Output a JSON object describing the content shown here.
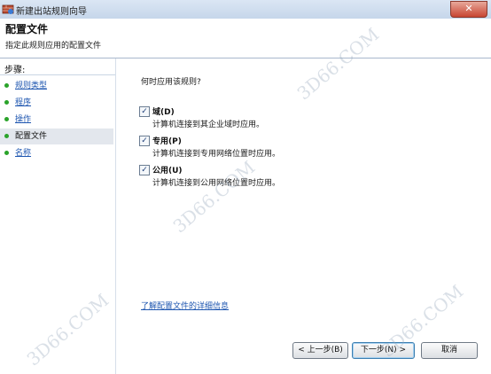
{
  "window": {
    "title": "新建出站规则向导",
    "close_glyph": "✕"
  },
  "header": {
    "title": "配置文件",
    "subtitle": "指定此规则应用的配置文件"
  },
  "sidebar": {
    "label": "步骤:",
    "items": [
      {
        "label": "规则类型",
        "state": "link"
      },
      {
        "label": "程序",
        "state": "link"
      },
      {
        "label": "操作",
        "state": "link"
      },
      {
        "label": "配置文件",
        "state": "current"
      },
      {
        "label": "名称",
        "state": "link"
      }
    ]
  },
  "main": {
    "question": "何时应用该规则?",
    "options": [
      {
        "title": "域(D)",
        "description": "计算机连接到其企业域时应用。",
        "checked": true
      },
      {
        "title": "专用(P)",
        "description": "计算机连接到专用网络位置时应用。",
        "checked": true
      },
      {
        "title": "公用(U)",
        "description": "计算机连接到公用网络位置时应用。",
        "checked": true
      }
    ],
    "learn_more": "了解配置文件的详细信息",
    "check_glyph": "✓"
  },
  "footer": {
    "back": "< 上一步(B)",
    "next": "下一步(N) >",
    "cancel": "取消"
  },
  "watermarks": [
    "3D66.COM",
    "3D66.COM",
    "3D66.COM",
    "3D66.COM"
  ],
  "colors": {
    "link": "#1e56b0",
    "step_dot": "#2aa32a",
    "current_step_bg": "#e3e7ed"
  }
}
